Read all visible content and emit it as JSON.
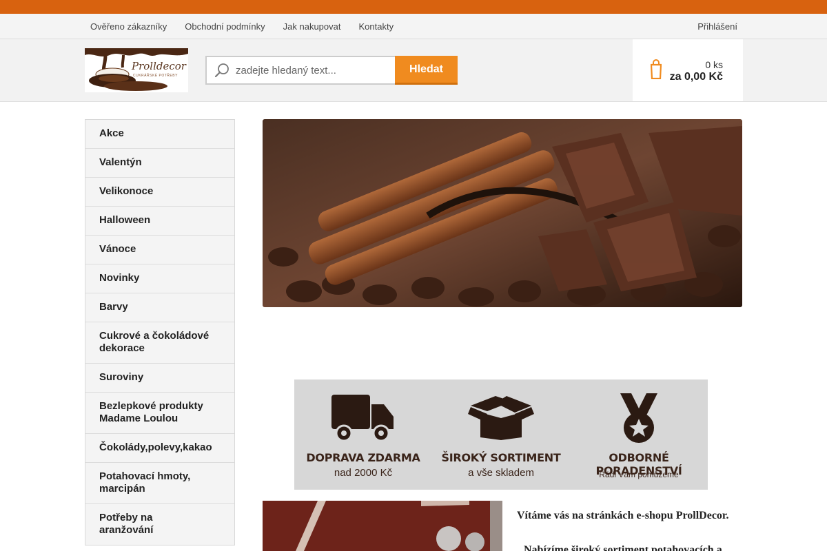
{
  "topbar": {
    "corner_icon": ""
  },
  "topnav": {
    "links": [
      "Ověřeno zákazníky",
      "Obchodní podmínky",
      "Jak nakupovat",
      "Kontakty"
    ],
    "login_icon": "",
    "login_label": "Přihlášení"
  },
  "header": {
    "logo_text": "Prolldecor",
    "logo_subtext": "CUKRÁŘSKÉ POTŘEBY",
    "search_placeholder": "zadejte hledaný text...",
    "search_button": "Hledat",
    "cart_qty": "0 ks",
    "cart_price": "za 0,00 Kč"
  },
  "sidebar": {
    "items": [
      {
        "label": "Akce",
        "arrow": ""
      },
      {
        "label": "Valentýn",
        "arrow": ""
      },
      {
        "label": "Velikonoce",
        "arrow": ""
      },
      {
        "label": "Halloween",
        "arrow": ""
      },
      {
        "label": "Vánoce",
        "arrow": ""
      },
      {
        "label": "Novinky",
        "arrow": ""
      },
      {
        "label": "Barvy",
        "arrow": ""
      },
      {
        "label": "Cukrové a čokoládové dekorace",
        "arrow": ""
      },
      {
        "label": "Suroviny",
        "arrow": ""
      },
      {
        "label": "Bezlepkové produkty Madame Loulou",
        "arrow": ""
      },
      {
        "label": "Čokolády,polevy,kakao",
        "arrow": ""
      },
      {
        "label": "Potahovací hmoty, marcipán",
        "arrow": ""
      },
      {
        "label": "Potřeby na aranžování",
        "arrow": ""
      }
    ]
  },
  "benefits": [
    {
      "title": "DOPRAVA ZDARMA",
      "subtitle": "nad 2000 Kč",
      "icon": "truck-icon"
    },
    {
      "title": "ŠIROKÝ SORTIMENT",
      "subtitle": "a vše skladem",
      "icon": "box-icon"
    },
    {
      "title": "ODBORNÉ PORADENSTVÍ",
      "subtitle": "Rádi Vám pomůžeme",
      "icon": "medal-icon"
    }
  ],
  "content": {
    "welcome": "Vítáme vás na stránkách e-shopu ProllDecor.",
    "intro": "Nabízíme široký sortiment potahovacích a"
  },
  "colors": {
    "accent": "#d8620f",
    "button": "#f08b1f",
    "cart_icon": "#f08b1f"
  }
}
